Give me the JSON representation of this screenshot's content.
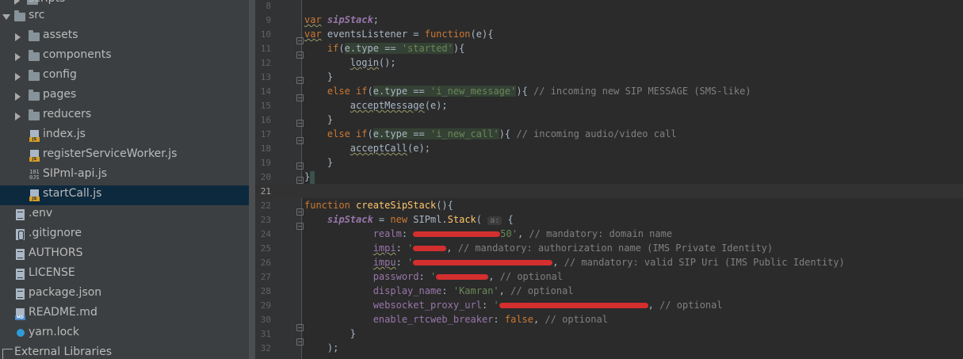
{
  "project_tree": {
    "items": [
      {
        "label": "scripts",
        "type": "folder",
        "indent": 0
      },
      {
        "label": "src",
        "type": "folder-open",
        "indent": 0
      },
      {
        "label": "assets",
        "type": "folder",
        "indent": 1
      },
      {
        "label": "components",
        "type": "folder",
        "indent": 1
      },
      {
        "label": "config",
        "type": "folder",
        "indent": 1
      },
      {
        "label": "pages",
        "type": "folder",
        "indent": 1
      },
      {
        "label": "reducers",
        "type": "folder",
        "indent": 1
      },
      {
        "label": "index.js",
        "type": "js-file",
        "indent": 1
      },
      {
        "label": "registerServiceWorker.js",
        "type": "js-file",
        "indent": 1
      },
      {
        "label": "SIPml-api.js",
        "type": "binary-js-file",
        "indent": 1
      },
      {
        "label": "startCall.js",
        "type": "js-file",
        "indent": 1,
        "selected": true
      },
      {
        "label": ".env",
        "type": "text-file",
        "indent": 0
      },
      {
        "label": ".gitignore",
        "type": "git-file",
        "indent": 0
      },
      {
        "label": "AUTHORS",
        "type": "text-file",
        "indent": 0
      },
      {
        "label": "LICENSE",
        "type": "text-file",
        "indent": 0
      },
      {
        "label": "package.json",
        "type": "json-file",
        "indent": 0
      },
      {
        "label": "README.md",
        "type": "md-file",
        "indent": 0
      },
      {
        "label": "yarn.lock",
        "type": "yarn-file",
        "indent": 0
      },
      {
        "label": "External Libraries",
        "type": "external-libraries",
        "indent": -1
      }
    ]
  },
  "editor": {
    "current_line": "21",
    "line_numbers": [
      "8",
      "9",
      "10",
      "11",
      "12",
      "13",
      "14",
      "15",
      "16",
      "17",
      "18",
      "19",
      "20",
      "21",
      "22",
      "23",
      "24",
      "25",
      "26",
      "27",
      "28",
      "29",
      "30",
      "31",
      "32"
    ],
    "code": {
      "l9_kw": "var",
      "l9_var": "sipStack",
      "l9_end": ";",
      "l10_kw": "var",
      "l10_name": " eventsListener = ",
      "l10_fnkw": "function",
      "l10_end": "(e){",
      "l11_kw": "if",
      "l11_cond": "e.type == ",
      "l11_str": "'started'",
      "l11_end": "){",
      "l12_call": "login",
      "l12_end": "();",
      "l13": "}",
      "l14_kw": "else if",
      "l14_cond": "e.type == ",
      "l14_str": "'i_new_message'",
      "l14_end": "){ ",
      "l14_cmt": "// incoming new SIP MESSAGE (SMS-like)",
      "l15_call": "acceptMessage",
      "l15_end": "(e);",
      "l16": "}",
      "l17_kw": "else if",
      "l17_cond": "e.type == ",
      "l17_str": "'i_new_call'",
      "l17_end": "){ ",
      "l17_cmt": "// incoming audio/video call",
      "l18_call": "acceptCall",
      "l18_end": "(e);",
      "l19": "}",
      "l20": "}",
      "l22_kw": "function",
      "l22_name": "createSipStack",
      "l22_end": "(){",
      "l23_var": "sipStack",
      "l23_eq": " = ",
      "l23_new": "new",
      "l23_cls": " SIPml.",
      "l23_stack": "Stack",
      "l23_paren": "( ",
      "l23_hint": "a:",
      "l23_brace": " {",
      "l24_key": "realm",
      "l24_str_end": "50'",
      "l24_cmt": "// mandatory: domain name",
      "l25_key": "impi",
      "l25_str_start": "'",
      "l25_cmt": "// mandatory: authorization name (IMS Private Identity)",
      "l26_key": "impu",
      "l26_str_start": "'",
      "l26_cmt": "// mandatory: valid SIP Uri (IMS Public Identity)",
      "l27_key": "password",
      "l27_str_start": "'",
      "l27_cmt": "// optional",
      "l28_key": "display_name",
      "l28_str": "'Kamran'",
      "l28_cmt": "// optional",
      "l29_key": "websocket_proxy_url",
      "l29_str_start": "'",
      "l29_cmt": "// optional",
      "l30_key": "enable_rtcweb_breaker",
      "l30_val": "false",
      "l30_cmt": "// optional",
      "l31": "}",
      "l32": ");"
    }
  },
  "colors": {
    "tree_bg": "#3c3f41",
    "editor_bg": "#2b2b2b",
    "keyword": "#cc7832",
    "string": "#6a8759",
    "comment": "#808080",
    "instance_var": "#9876aa",
    "function_name": "#ffc66d",
    "redaction": "#d32f2f"
  }
}
